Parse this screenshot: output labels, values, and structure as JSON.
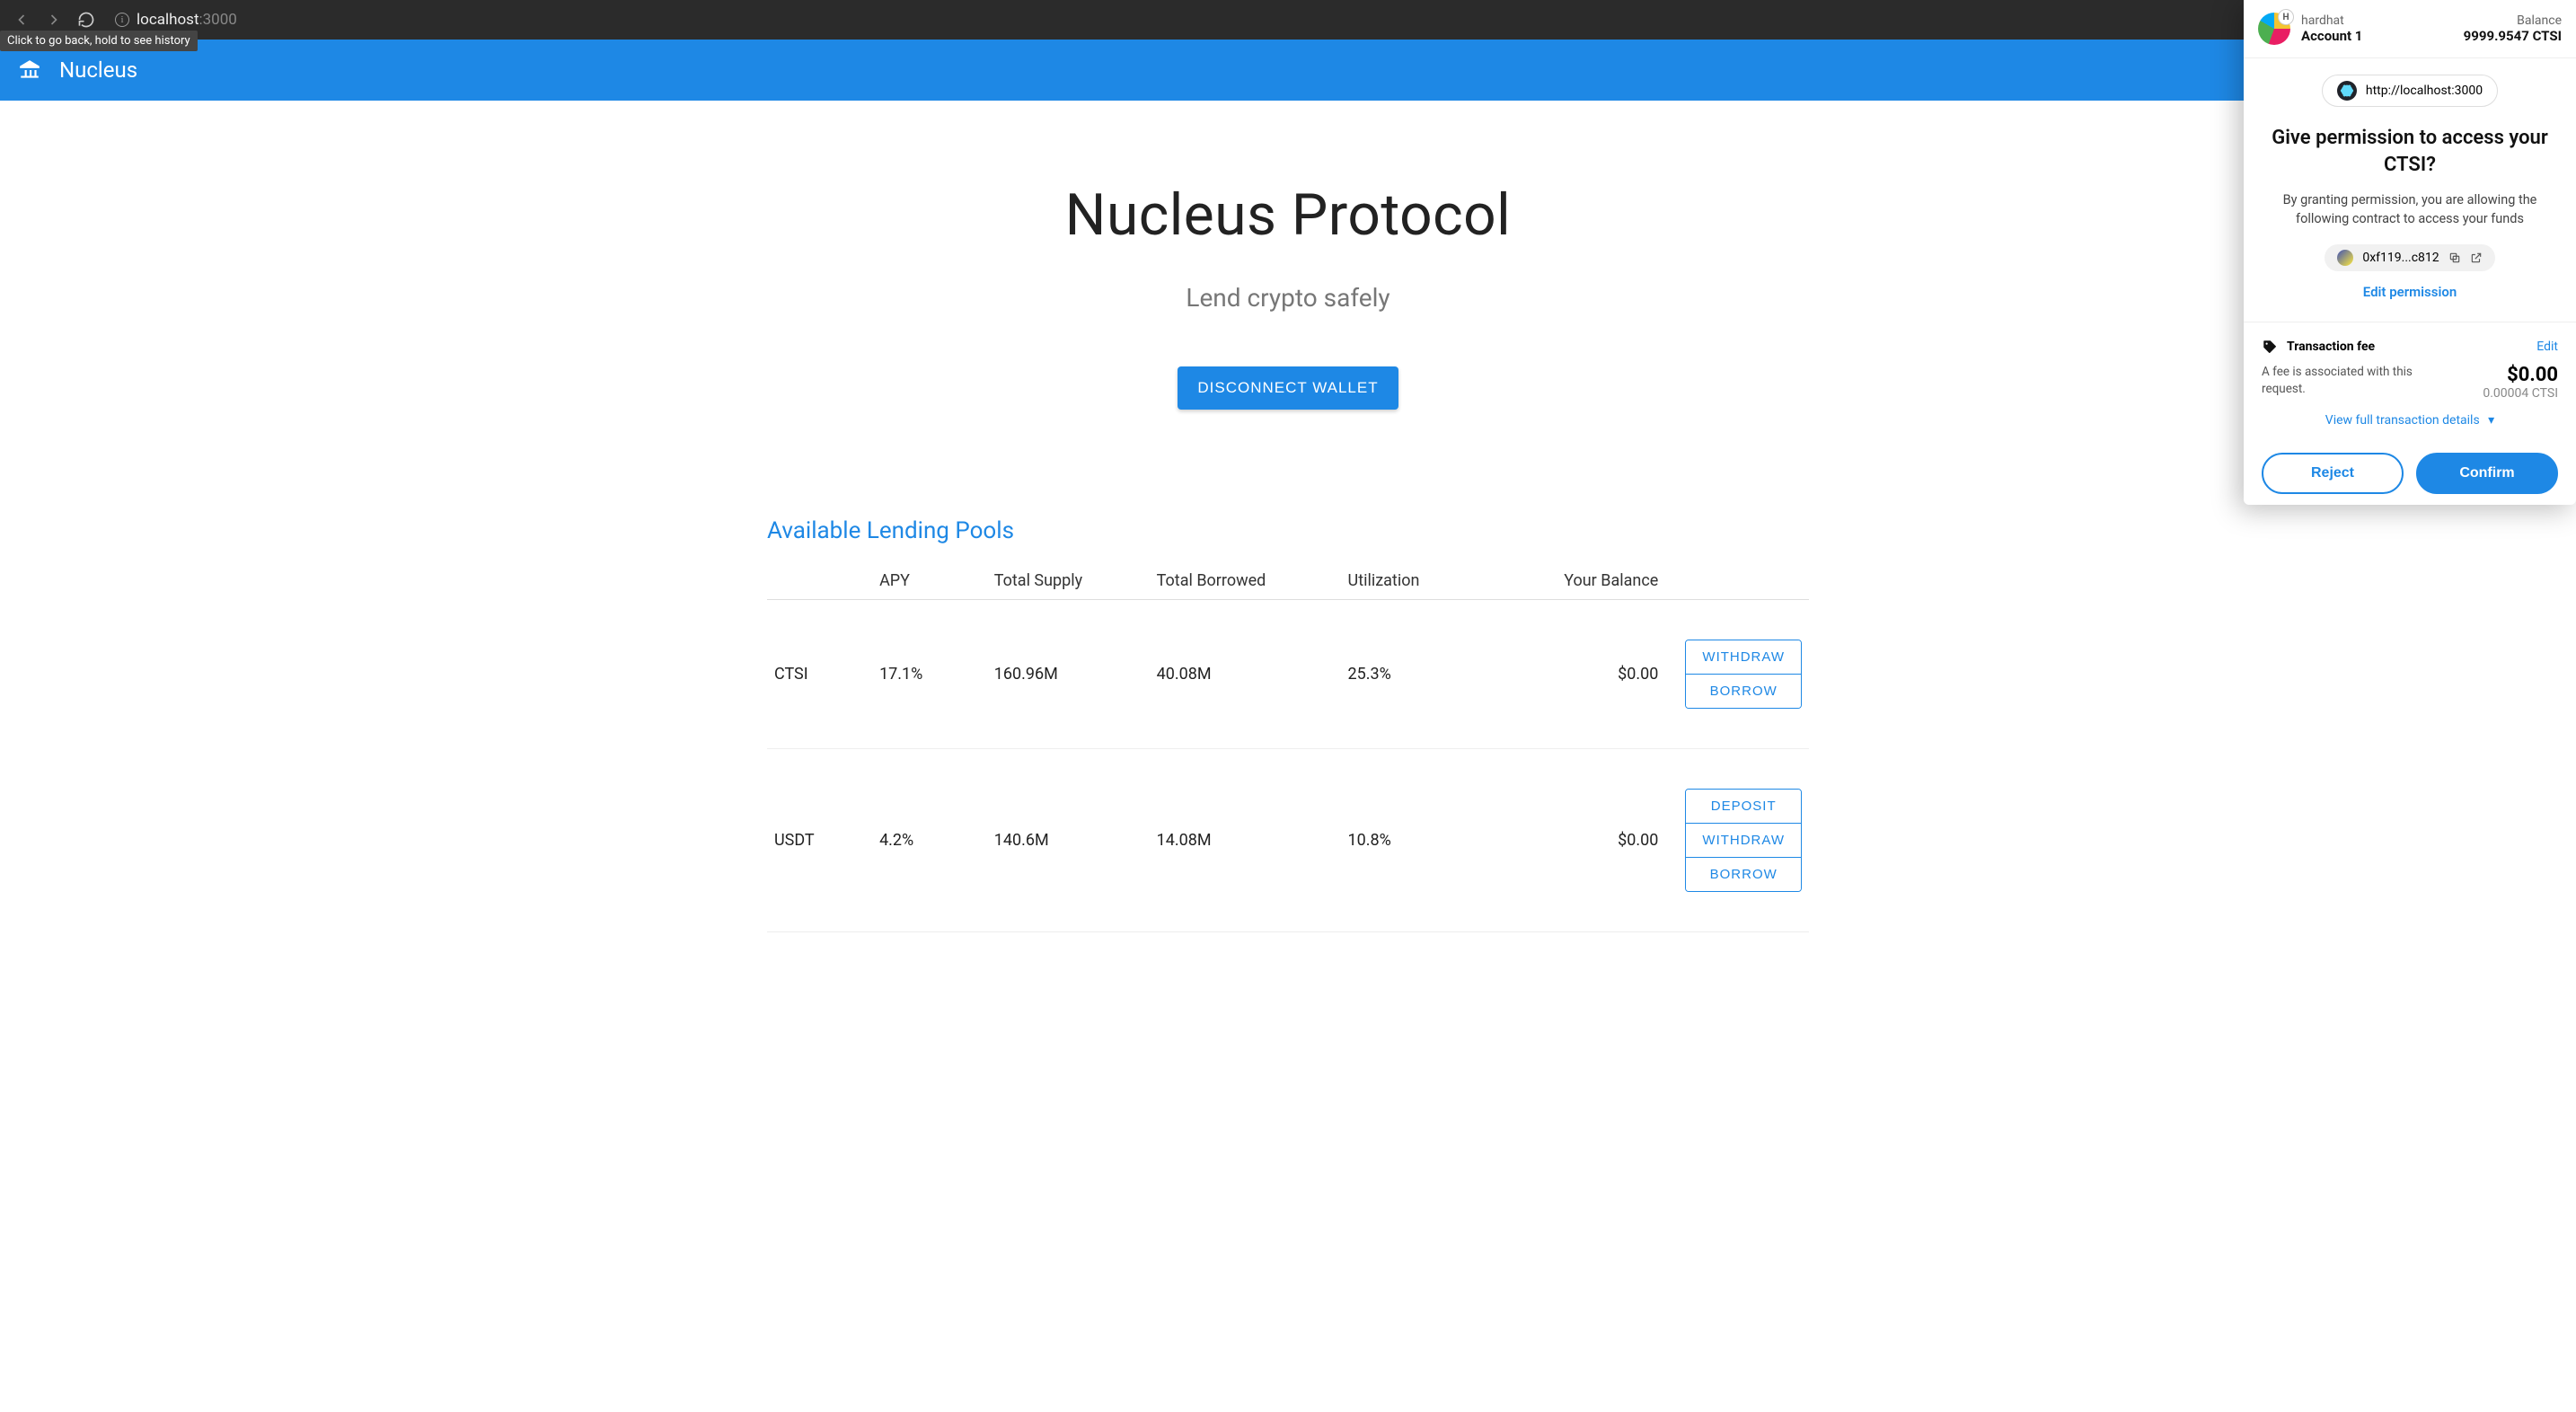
{
  "browser": {
    "back_tooltip": "Click to go back, hold to see history",
    "url_host": "localhost",
    "url_port": ":3000"
  },
  "app": {
    "title": "Nucleus"
  },
  "hero": {
    "title": "Nucleus Protocol",
    "subtitle": "Lend crypto safely",
    "disconnect_label": "DISCONNECT WALLET"
  },
  "pools": {
    "title": "Available Lending Pools",
    "columns": {
      "asset": "",
      "apy": "APY",
      "total_supply": "Total Supply",
      "total_borrowed": "Total Borrowed",
      "utilization": "Utilization",
      "your_balance": "Your Balance",
      "actions": ""
    },
    "action_labels": {
      "deposit": "DEPOSIT",
      "withdraw": "WITHDRAW",
      "borrow": "BORROW"
    },
    "rows": [
      {
        "asset": "CTSI",
        "apy": "17.1%",
        "total_supply": "160.96M",
        "total_borrowed": "40.08M",
        "utilization": "25.3%",
        "your_balance": "$0.00"
      },
      {
        "asset": "USDT",
        "apy": "4.2%",
        "total_supply": "140.6M",
        "total_borrowed": "14.08M",
        "utilization": "10.8%",
        "your_balance": "$0.00"
      }
    ]
  },
  "wallet": {
    "network": "hardhat",
    "account_name": "Account 1",
    "balance_label": "Balance",
    "balance_value": "9999.9547 CTSI",
    "origin_url": "http://localhost:3000",
    "perm_title": "Give permission to access your CTSI?",
    "perm_desc": "By granting permission, you are allowing the following contract to access your funds",
    "contract_addr": "0xf119...c812",
    "edit_permission": "Edit permission",
    "fee": {
      "title": "Transaction fee",
      "edit": "Edit",
      "desc": "A fee is associated with this request.",
      "amount_main": "$0.00",
      "amount_sub": "0.00004 CTSI",
      "view_full": "View full transaction details"
    },
    "actions": {
      "reject": "Reject",
      "confirm": "Confirm"
    }
  }
}
